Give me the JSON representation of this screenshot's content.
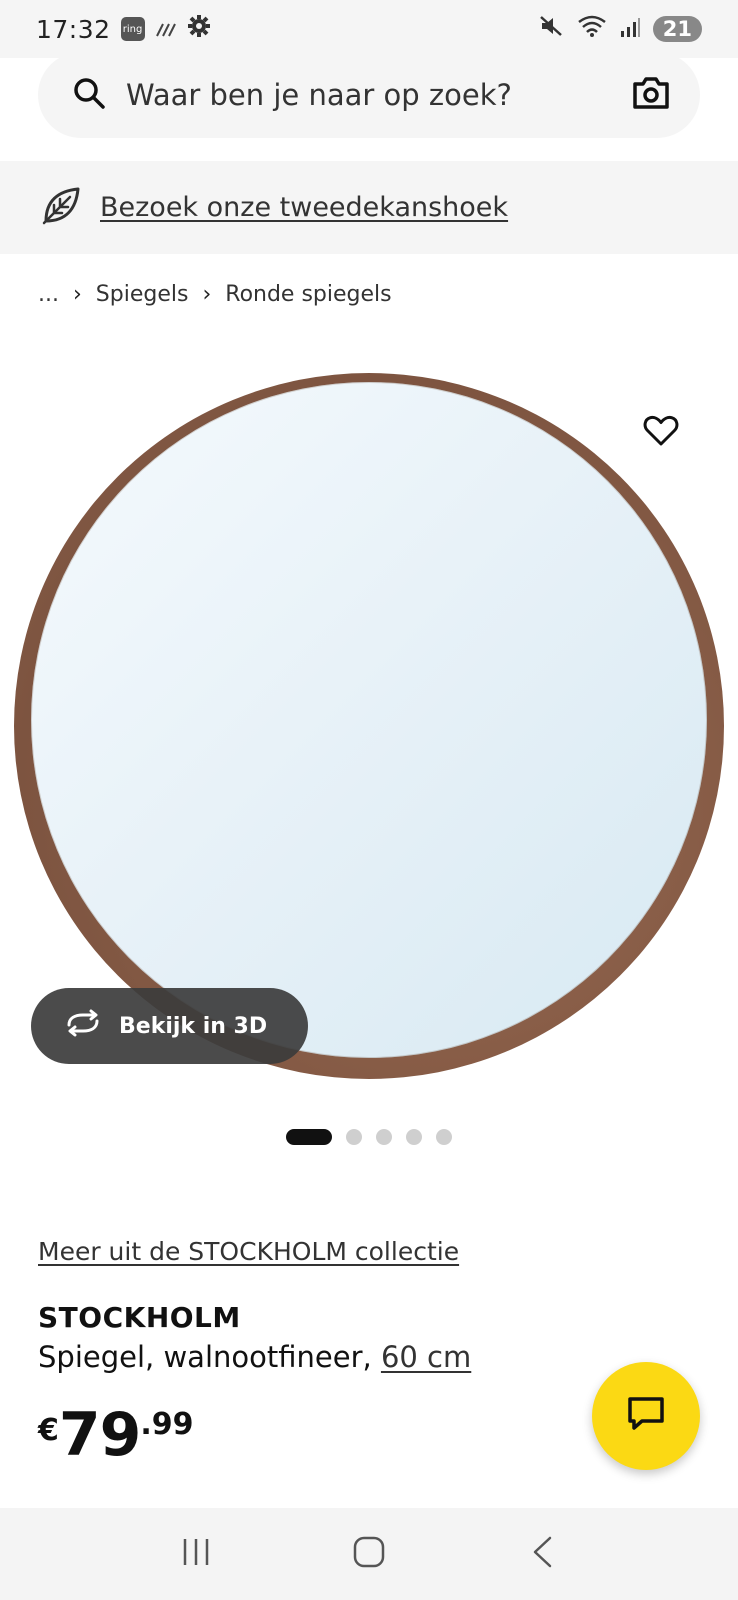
{
  "status_bar": {
    "time": "17:32",
    "ring_label": "ring",
    "battery": "21"
  },
  "search": {
    "placeholder": "Waar ben je naar op zoek?"
  },
  "banner": {
    "link_text": "Bezoek onze tweedekanshoek"
  },
  "breadcrumb": {
    "ellipsis": "...",
    "items": [
      "Spiegels",
      "Ronde spiegels"
    ]
  },
  "gallery": {
    "view_3d_label": "Bekijk in 3D",
    "image_count": 5,
    "active_index": 0
  },
  "product": {
    "collection_link": "Meer uit de STOCKHOLM collectie",
    "name": "STOCKHOLM",
    "description": "Spiegel, walnootfineer, ",
    "size_link": "60 cm",
    "price_currency": "€",
    "price_integer": "79",
    "price_decimal": ".99"
  },
  "colors": {
    "accent_yellow": "#fbd914",
    "panel_gray": "#f5f5f5"
  }
}
